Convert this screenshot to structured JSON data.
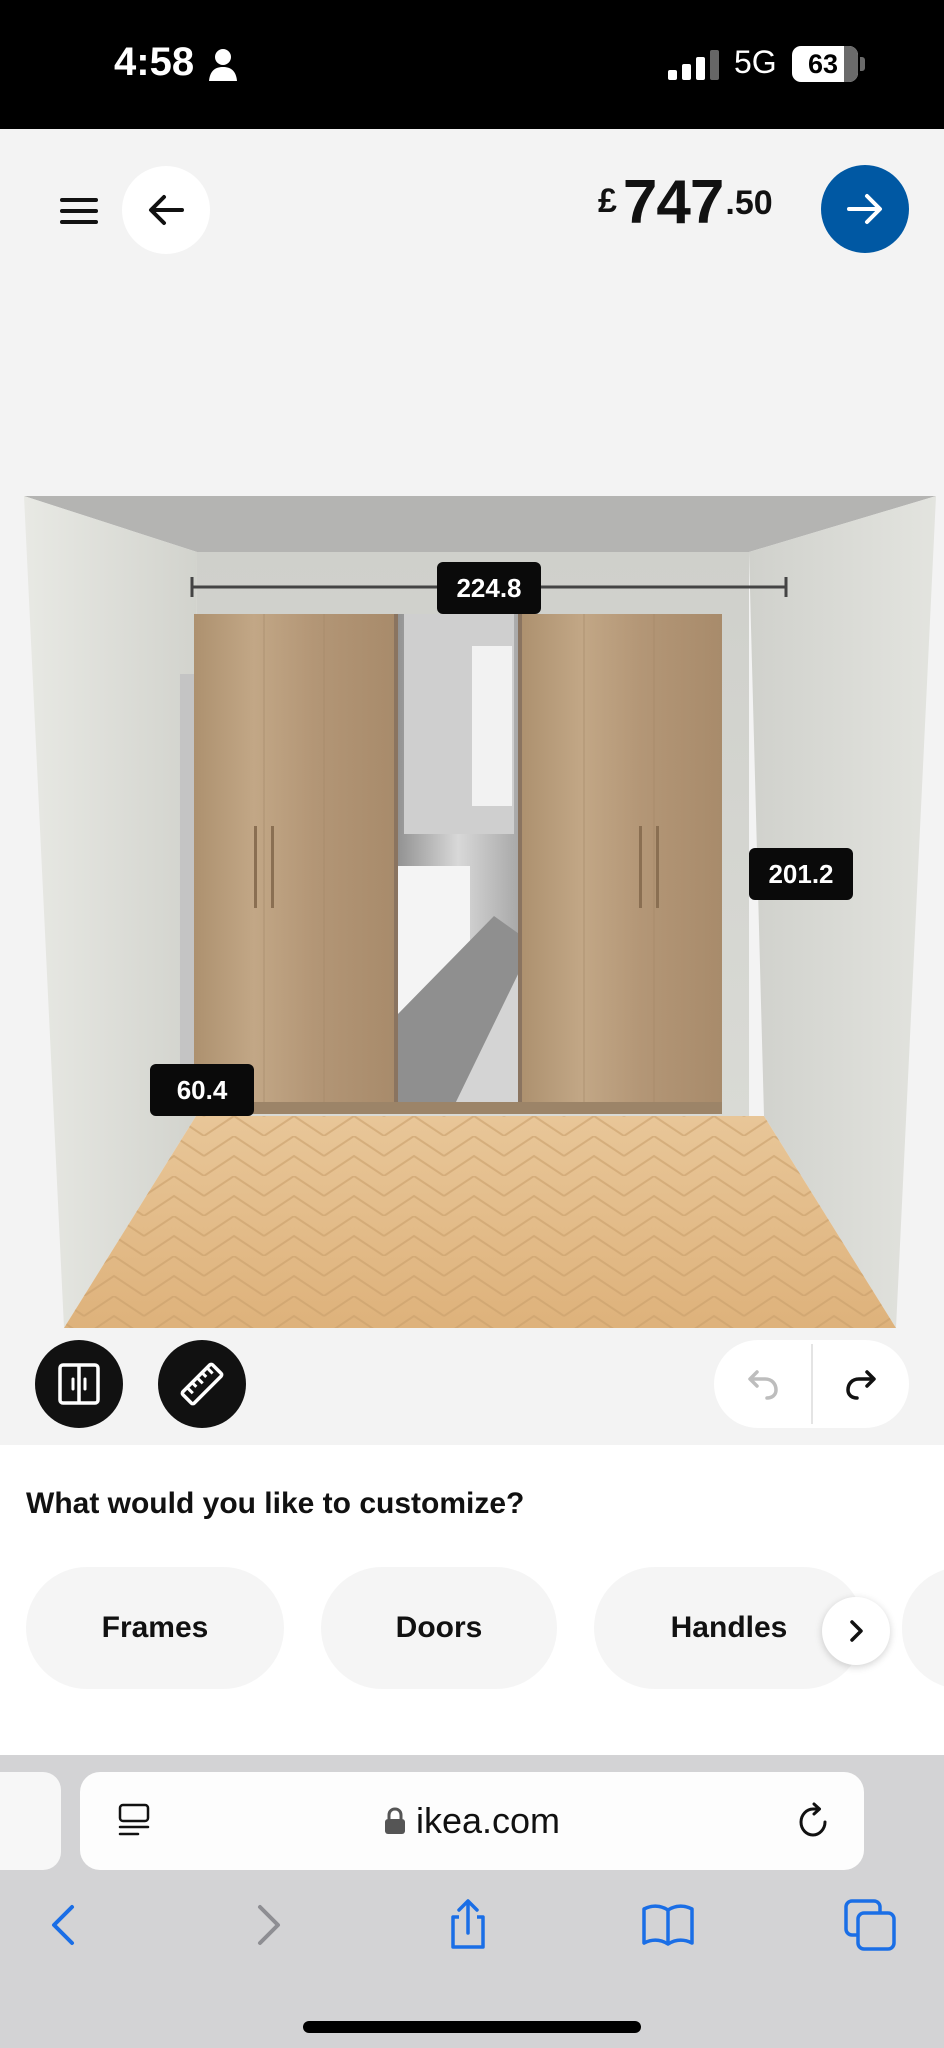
{
  "status_bar": {
    "time": "4:58",
    "network": "5G",
    "battery": "63"
  },
  "header": {
    "currency": "£",
    "price_main": "747",
    "price_decimal": ".50"
  },
  "scene": {
    "width_label": "224.8",
    "height_label": "201.2",
    "depth_label": "60.4"
  },
  "customize": {
    "title": "What would you like to customize?",
    "options": [
      "Frames",
      "Doors",
      "Handles"
    ]
  },
  "browser": {
    "url": "ikea.com"
  },
  "colors": {
    "accent": "#0058a3",
    "wood": "#b89a78",
    "floor": "#e2b882"
  }
}
